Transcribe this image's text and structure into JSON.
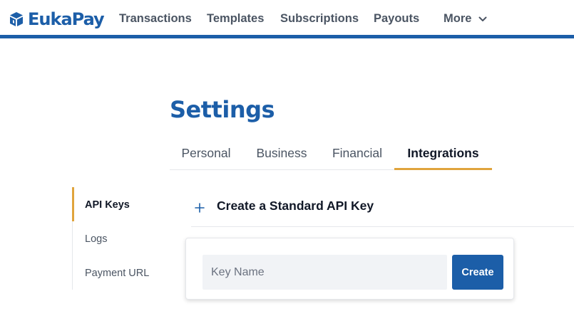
{
  "brand": {
    "name": "EukaPay",
    "icon": "cube-icon",
    "color": "#1c5ea8"
  },
  "nav": {
    "items": [
      "Transactions",
      "Templates",
      "Subscriptions",
      "Payouts"
    ],
    "more_label": "More",
    "more_icon": "chevron-down-icon"
  },
  "page": {
    "title": "Settings"
  },
  "tabs": {
    "items": [
      "Personal",
      "Business",
      "Financial",
      "Integrations"
    ],
    "active": "Integrations",
    "accent_color": "#e0a43c"
  },
  "side_menu": {
    "items": [
      "API Keys",
      "Logs",
      "Payment URL"
    ],
    "active": "API Keys"
  },
  "api_key": {
    "section_title": "Create a Standard API Key",
    "expand_icon": "plus-icon",
    "name_placeholder": "Key Name",
    "name_value": "",
    "create_label": "Create"
  }
}
